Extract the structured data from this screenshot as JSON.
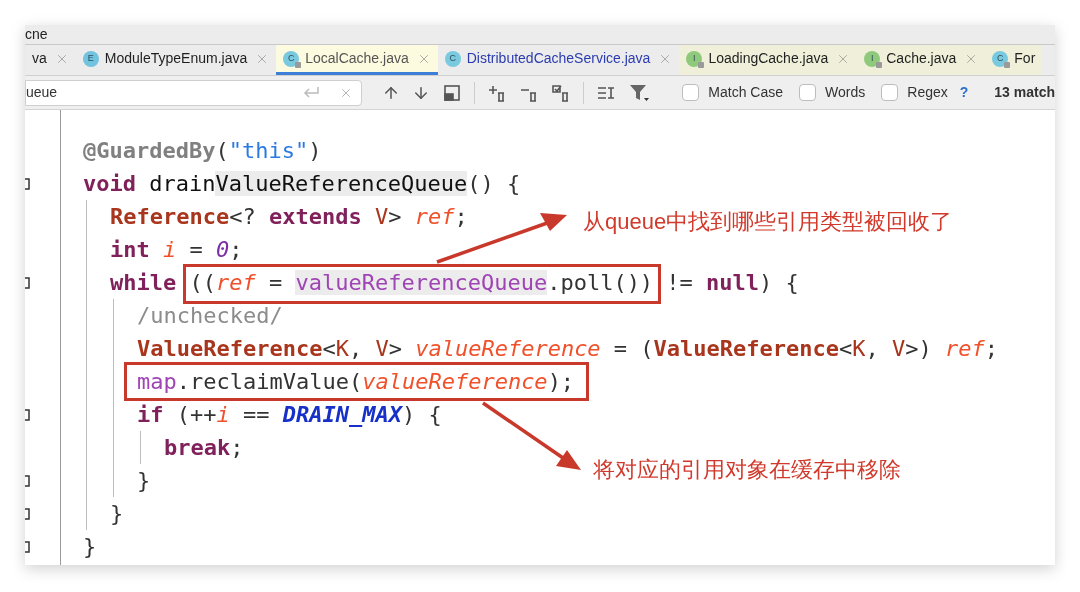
{
  "window": {
    "title": "cne"
  },
  "tabs": [
    {
      "label": "va",
      "selected": false,
      "modified": false,
      "color": "#ececec",
      "close_button": true
    },
    {
      "label": "ModuleTypeEnum.java",
      "selected": false,
      "modified": false,
      "color": "#ececec",
      "close_button": true,
      "icon": {
        "letter": "E",
        "color": "#72c3df",
        "locked": false
      }
    },
    {
      "label": "LocalCache.java",
      "selected": true,
      "modified": false,
      "color": "#fcfbe0",
      "close_button": true,
      "icon": {
        "letter": "C",
        "color": "#79c9df",
        "locked": true
      }
    },
    {
      "label": "DistributedCacheService.java",
      "selected": false,
      "modified": true,
      "color": "#ececec",
      "close_button": true,
      "icon": {
        "letter": "C",
        "color": "#79c9df",
        "locked": false
      }
    },
    {
      "label": "LoadingCache.java",
      "selected": false,
      "modified": false,
      "color": "#f0f0da",
      "close_button": true,
      "icon": {
        "letter": "I",
        "color": "#8fca7c",
        "locked": true
      }
    },
    {
      "label": "Cache.java",
      "selected": false,
      "modified": false,
      "color": "#f0f0da",
      "close_button": true,
      "icon": {
        "letter": "I",
        "color": "#8fca7c",
        "locked": true
      }
    },
    {
      "label": "For",
      "selected": false,
      "modified": false,
      "color": "#f0f0da",
      "close_button": false,
      "icon": {
        "letter": "C",
        "color": "#79c9df",
        "locked": true
      }
    }
  ],
  "search": {
    "value": "ueue",
    "options": [
      {
        "label": "Match Case",
        "checked": false
      },
      {
        "label": "Words",
        "checked": false
      },
      {
        "label": "Regex",
        "checked": false
      }
    ],
    "help": "?",
    "matches": "13 match"
  },
  "code": {
    "lines": [
      {
        "fold_marker": false,
        "tokens": [
          {
            "kind": "annotation",
            "text": "@GuardedBy",
            "match": false
          },
          {
            "kind": "punct",
            "text": "(",
            "match": false
          },
          {
            "kind": "string",
            "text": "\"this\"",
            "match": false
          },
          {
            "kind": "punct",
            "text": ")",
            "match": false
          }
        ]
      },
      {
        "fold_marker": true,
        "tokens": [
          {
            "kind": "keyword",
            "text": "void",
            "match": false
          },
          {
            "kind": "plain",
            "text": " drain",
            "match": false
          },
          {
            "kind": "plain",
            "text": "ValueReferenceQueue",
            "match": true
          },
          {
            "kind": "punct",
            "text": "() {",
            "match": false
          }
        ],
        "children": [
          {
            "fold_marker": false,
            "tokens": [
              {
                "kind": "type",
                "text": "Reference",
                "match": false
              },
              {
                "kind": "punct",
                "text": "<? ",
                "match": false
              },
              {
                "kind": "keyword",
                "text": "extends",
                "match": false
              },
              {
                "kind": "typeparam",
                "text": " V",
                "match": false
              },
              {
                "kind": "punct",
                "text": "> ",
                "match": false
              },
              {
                "kind": "local",
                "text": "ref",
                "match": false
              },
              {
                "kind": "punct",
                "text": ";",
                "match": false
              }
            ]
          },
          {
            "fold_marker": false,
            "tokens": [
              {
                "kind": "keyword",
                "text": "int",
                "match": false
              },
              {
                "kind": "local",
                "text": " i",
                "match": false
              },
              {
                "kind": "punct",
                "text": " = ",
                "match": false
              },
              {
                "kind": "number",
                "text": "0",
                "match": false
              },
              {
                "kind": "punct",
                "text": ";",
                "match": false
              }
            ]
          },
          {
            "fold_marker": true,
            "tokens": [
              {
                "kind": "keyword",
                "text": "while",
                "match": false
              },
              {
                "kind": "punct",
                "text": " ((",
                "match": false
              },
              {
                "kind": "local",
                "text": "ref",
                "match": false
              },
              {
                "kind": "punct",
                "text": " = ",
                "match": false
              },
              {
                "kind": "field",
                "text": "valueReferenceQueue",
                "match": true
              },
              {
                "kind": "punct",
                "text": ".poll()) != ",
                "match": false
              },
              {
                "kind": "keyword",
                "text": "null",
                "match": false
              },
              {
                "kind": "punct",
                "text": ") {",
                "match": false
              }
            ],
            "children": [
              {
                "fold_marker": false,
                "tokens": [
                  {
                    "kind": "comment",
                    "text": "/unchecked/",
                    "match": false
                  }
                ]
              },
              {
                "fold_marker": false,
                "tokens": [
                  {
                    "kind": "type",
                    "text": "ValueReference",
                    "match": false
                  },
                  {
                    "kind": "punct",
                    "text": "<",
                    "match": false
                  },
                  {
                    "kind": "typeparam",
                    "text": "K",
                    "match": false
                  },
                  {
                    "kind": "punct",
                    "text": ", ",
                    "match": false
                  },
                  {
                    "kind": "typeparam",
                    "text": "V",
                    "match": false
                  },
                  {
                    "kind": "punct",
                    "text": "> ",
                    "match": false
                  },
                  {
                    "kind": "local",
                    "text": "valueReference",
                    "match": false
                  },
                  {
                    "kind": "punct",
                    "text": " = (",
                    "match": false
                  },
                  {
                    "kind": "type",
                    "text": "ValueReference",
                    "match": false
                  },
                  {
                    "kind": "punct",
                    "text": "<",
                    "match": false
                  },
                  {
                    "kind": "typeparam",
                    "text": "K",
                    "match": false
                  },
                  {
                    "kind": "punct",
                    "text": ", ",
                    "match": false
                  },
                  {
                    "kind": "typeparam",
                    "text": "V",
                    "match": false
                  },
                  {
                    "kind": "punct",
                    "text": ">) ",
                    "match": false
                  },
                  {
                    "kind": "local",
                    "text": "ref",
                    "match": false
                  },
                  {
                    "kind": "punct",
                    "text": ";",
                    "match": false
                  }
                ]
              },
              {
                "fold_marker": false,
                "tokens": [
                  {
                    "kind": "field",
                    "text": "map",
                    "match": false
                  },
                  {
                    "kind": "punct",
                    "text": ".reclaimValue(",
                    "match": false
                  },
                  {
                    "kind": "local",
                    "text": "valueReference",
                    "match": false
                  },
                  {
                    "kind": "punct",
                    "text": ");",
                    "match": false
                  }
                ]
              },
              {
                "fold_marker": true,
                "tokens": [
                  {
                    "kind": "keyword",
                    "text": "if",
                    "match": false
                  },
                  {
                    "kind": "punct",
                    "text": " (++",
                    "match": false
                  },
                  {
                    "kind": "local",
                    "text": "i",
                    "match": false
                  },
                  {
                    "kind": "punct",
                    "text": " == ",
                    "match": false
                  },
                  {
                    "kind": "constant",
                    "text": "DRAIN_MAX",
                    "match": false
                  },
                  {
                    "kind": "punct",
                    "text": ") {",
                    "match": false
                  }
                ],
                "children": [
                  {
                    "fold_marker": false,
                    "tokens": [
                      {
                        "kind": "keyword",
                        "text": "break",
                        "match": false
                      },
                      {
                        "kind": "punct",
                        "text": ";",
                        "match": false
                      }
                    ]
                  }
                ]
              },
              {
                "fold_marker": true,
                "tokens": [
                  {
                    "kind": "punct",
                    "text": "}",
                    "match": false
                  }
                ]
              }
            ]
          },
          {
            "fold_marker": true,
            "tokens": [
              {
                "kind": "punct",
                "text": "}",
                "match": false
              }
            ]
          }
        ]
      },
      {
        "fold_marker": true,
        "tokens": [
          {
            "kind": "punct",
            "text": "}",
            "match": false
          }
        ]
      }
    ]
  },
  "callouts": [
    {
      "text": "从queue中找到哪些引用类型被回收了"
    },
    {
      "text": "将对应的引用对象在缓存中移除"
    }
  ]
}
